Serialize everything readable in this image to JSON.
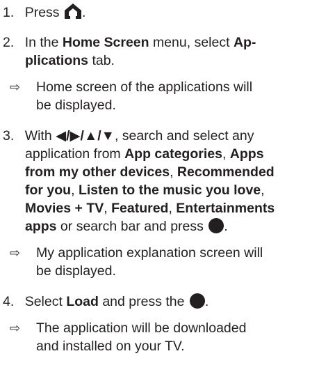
{
  "steps": [
    {
      "number": "1.",
      "text_before": "Press",
      "icon": "home-icon",
      "text_after": "."
    },
    {
      "number": "2.",
      "parts": [
        "In the ",
        "Home Screen",
        " menu, select ",
        "Ap-",
        "plications",
        " tab."
      ],
      "result": {
        "arrow": "⇨",
        "lines": [
          "Home screen of the applications will",
          "be displayed."
        ]
      }
    },
    {
      "number": "3.",
      "line1_prefix": "With ",
      "nav_symbols": "◀/▶/▲/▼",
      "line1_suffix": ", search and select any",
      "line2_text": "application from ",
      "line2_bold": "App categories",
      "line2_comma": ", ",
      "line2_bold2": "Apps",
      "line3_bold": "from my other devices",
      "line3_comma": ", ",
      "line3_bold2": "Recommended",
      "line4_bold": "for you",
      "line4_comma": ", ",
      "line4_bold2": "Listen to the music you love",
      "line4_end": ",",
      "line5_bold": "Movies + TV",
      "line5_comma": ", ",
      "line5_bold2": "Featured",
      "line5_comma2": ", ",
      "line5_bold3": "Entertainments",
      "line6_bold": "apps",
      "line6_text": " or search bar and press",
      "line6_end": ".",
      "icon": "ok-button-icon",
      "result": {
        "arrow": "⇨",
        "lines": [
          "My application explanation screen will",
          "be displayed."
        ]
      }
    },
    {
      "number": "4.",
      "text_before": "Select ",
      "bold": "Load",
      "text_middle": " and press the",
      "icon": "ok-button-icon",
      "text_after": ".",
      "result": {
        "arrow": "⇨",
        "lines": [
          "The application will be downloaded",
          "and installed on your TV."
        ]
      }
    }
  ]
}
